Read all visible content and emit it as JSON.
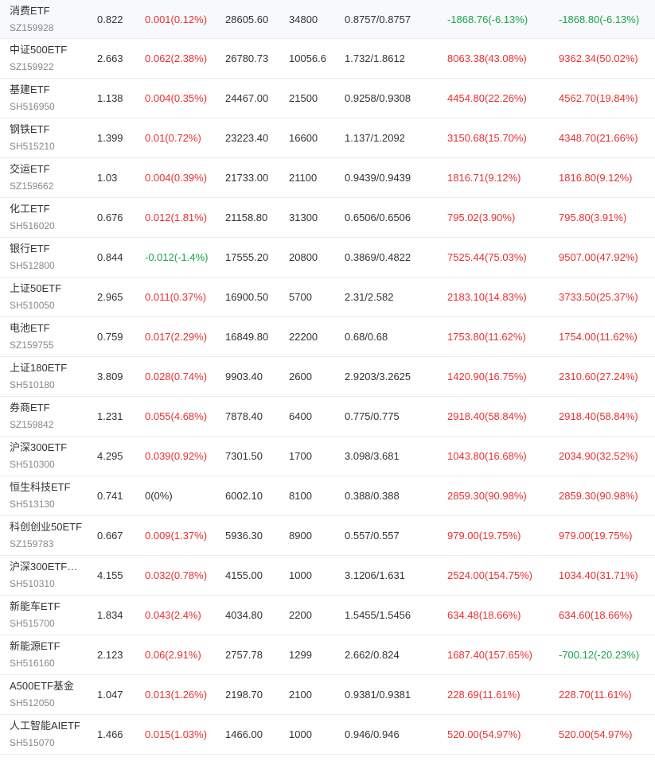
{
  "colors": {
    "up": "#e93030",
    "down": "#1aa34a",
    "flat": "#333333"
  },
  "rows": [
    {
      "name": "消费ETF",
      "code": "SZ159928",
      "price": "0.822",
      "change": "0.001(0.12%)",
      "change_dir": "up",
      "value": "28605.60",
      "shares": "34800",
      "cost": "0.8757/0.8757",
      "pnl1": "-1868.76(-6.13%)",
      "pnl1_dir": "down",
      "pnl2": "-1868.80(-6.13%)",
      "pnl2_dir": "down"
    },
    {
      "name": "中证500ETF",
      "code": "SZ159922",
      "price": "2.663",
      "change": "0.062(2.38%)",
      "change_dir": "up",
      "value": "26780.73",
      "shares": "10056.6",
      "cost": "1.732/1.8612",
      "pnl1": "8063.38(43.08%)",
      "pnl1_dir": "up",
      "pnl2": "9362.34(50.02%)",
      "pnl2_dir": "up"
    },
    {
      "name": "基建ETF",
      "code": "SH516950",
      "price": "1.138",
      "change": "0.004(0.35%)",
      "change_dir": "up",
      "value": "24467.00",
      "shares": "21500",
      "cost": "0.9258/0.9308",
      "pnl1": "4454.80(22.26%)",
      "pnl1_dir": "up",
      "pnl2": "4562.70(19.84%)",
      "pnl2_dir": "up"
    },
    {
      "name": "钢铁ETF",
      "code": "SH515210",
      "price": "1.399",
      "change": "0.01(0.72%)",
      "change_dir": "up",
      "value": "23223.40",
      "shares": "16600",
      "cost": "1.137/1.2092",
      "pnl1": "3150.68(15.70%)",
      "pnl1_dir": "up",
      "pnl2": "4348.70(21.66%)",
      "pnl2_dir": "up"
    },
    {
      "name": "交运ETF",
      "code": "SZ159662",
      "price": "1.03",
      "change": "0.004(0.39%)",
      "change_dir": "up",
      "value": "21733.00",
      "shares": "21100",
      "cost": "0.9439/0.9439",
      "pnl1": "1816.71(9.12%)",
      "pnl1_dir": "up",
      "pnl2": "1816.80(9.12%)",
      "pnl2_dir": "up"
    },
    {
      "name": "化工ETF",
      "code": "SH516020",
      "price": "0.676",
      "change": "0.012(1.81%)",
      "change_dir": "up",
      "value": "21158.80",
      "shares": "31300",
      "cost": "0.6506/0.6506",
      "pnl1": "795.02(3.90%)",
      "pnl1_dir": "up",
      "pnl2": "795.80(3.91%)",
      "pnl2_dir": "up"
    },
    {
      "name": "银行ETF",
      "code": "SH512800",
      "price": "0.844",
      "change": "-0.012(-1.4%)",
      "change_dir": "down",
      "value": "17555.20",
      "shares": "20800",
      "cost": "0.3869/0.4822",
      "pnl1": "7525.44(75.03%)",
      "pnl1_dir": "up",
      "pnl2": "9507.00(47.92%)",
      "pnl2_dir": "up"
    },
    {
      "name": "上证50ETF",
      "code": "SH510050",
      "price": "2.965",
      "change": "0.011(0.37%)",
      "change_dir": "up",
      "value": "16900.50",
      "shares": "5700",
      "cost": "2.31/2.582",
      "pnl1": "2183.10(14.83%)",
      "pnl1_dir": "up",
      "pnl2": "3733.50(25.37%)",
      "pnl2_dir": "up"
    },
    {
      "name": "电池ETF",
      "code": "SZ159755",
      "price": "0.759",
      "change": "0.017(2.29%)",
      "change_dir": "up",
      "value": "16849.80",
      "shares": "22200",
      "cost": "0.68/0.68",
      "pnl1": "1753.80(11.62%)",
      "pnl1_dir": "up",
      "pnl2": "1754.00(11.62%)",
      "pnl2_dir": "up"
    },
    {
      "name": "上证180ETF",
      "code": "SH510180",
      "price": "3.809",
      "change": "0.028(0.74%)",
      "change_dir": "up",
      "value": "9903.40",
      "shares": "2600",
      "cost": "2.9203/3.2625",
      "pnl1": "1420.90(16.75%)",
      "pnl1_dir": "up",
      "pnl2": "2310.60(27.24%)",
      "pnl2_dir": "up"
    },
    {
      "name": "券商ETF",
      "code": "SZ159842",
      "price": "1.231",
      "change": "0.055(4.68%)",
      "change_dir": "up",
      "value": "7878.40",
      "shares": "6400",
      "cost": "0.775/0.775",
      "pnl1": "2918.40(58.84%)",
      "pnl1_dir": "up",
      "pnl2": "2918.40(58.84%)",
      "pnl2_dir": "up"
    },
    {
      "name": "沪深300ETF",
      "code": "SH510300",
      "price": "4.295",
      "change": "0.039(0.92%)",
      "change_dir": "up",
      "value": "7301.50",
      "shares": "1700",
      "cost": "3.098/3.681",
      "pnl1": "1043.80(16.68%)",
      "pnl1_dir": "up",
      "pnl2": "2034.90(32.52%)",
      "pnl2_dir": "up"
    },
    {
      "name": "恒生科技ETF",
      "code": "SH513130",
      "price": "0.741",
      "change": "0(0%)",
      "change_dir": "flat",
      "value": "6002.10",
      "shares": "8100",
      "cost": "0.388/0.388",
      "pnl1": "2859.30(90.98%)",
      "pnl1_dir": "up",
      "pnl2": "2859.30(90.98%)",
      "pnl2_dir": "up"
    },
    {
      "name": "科创创业50ETF",
      "code": "SZ159783",
      "price": "0.667",
      "change": "0.009(1.37%)",
      "change_dir": "up",
      "value": "5936.30",
      "shares": "8900",
      "cost": "0.557/0.557",
      "pnl1": "979.00(19.75%)",
      "pnl1_dir": "up",
      "pnl2": "979.00(19.75%)",
      "pnl2_dir": "up"
    },
    {
      "name": "沪深300ETF…",
      "code": "SH510310",
      "price": "4.155",
      "change": "0.032(0.78%)",
      "change_dir": "up",
      "value": "4155.00",
      "shares": "1000",
      "cost": "3.1206/1.631",
      "pnl1": "2524.00(154.75%)",
      "pnl1_dir": "up",
      "pnl2": "1034.40(31.71%)",
      "pnl2_dir": "up"
    },
    {
      "name": "新能车ETF",
      "code": "SH515700",
      "price": "1.834",
      "change": "0.043(2.4%)",
      "change_dir": "up",
      "value": "4034.80",
      "shares": "2200",
      "cost": "1.5455/1.5456",
      "pnl1": "634.48(18.66%)",
      "pnl1_dir": "up",
      "pnl2": "634.60(18.66%)",
      "pnl2_dir": "up"
    },
    {
      "name": "新能源ETF",
      "code": "SH516160",
      "price": "2.123",
      "change": "0.06(2.91%)",
      "change_dir": "up",
      "value": "2757.78",
      "shares": "1299",
      "cost": "2.662/0.824",
      "pnl1": "1687.40(157.65%)",
      "pnl1_dir": "up",
      "pnl2": "-700.12(-20.23%)",
      "pnl2_dir": "down"
    },
    {
      "name": "A500ETF基金",
      "code": "SH512050",
      "price": "1.047",
      "change": "0.013(1.26%)",
      "change_dir": "up",
      "value": "2198.70",
      "shares": "2100",
      "cost": "0.9381/0.9381",
      "pnl1": "228.69(11.61%)",
      "pnl1_dir": "up",
      "pnl2": "228.70(11.61%)",
      "pnl2_dir": "up"
    },
    {
      "name": "人工智能AIETF",
      "code": "SH515070",
      "price": "1.466",
      "change": "0.015(1.03%)",
      "change_dir": "up",
      "value": "1466.00",
      "shares": "1000",
      "cost": "0.946/0.946",
      "pnl1": "520.00(54.97%)",
      "pnl1_dir": "up",
      "pnl2": "520.00(54.97%)",
      "pnl2_dir": "up"
    }
  ]
}
